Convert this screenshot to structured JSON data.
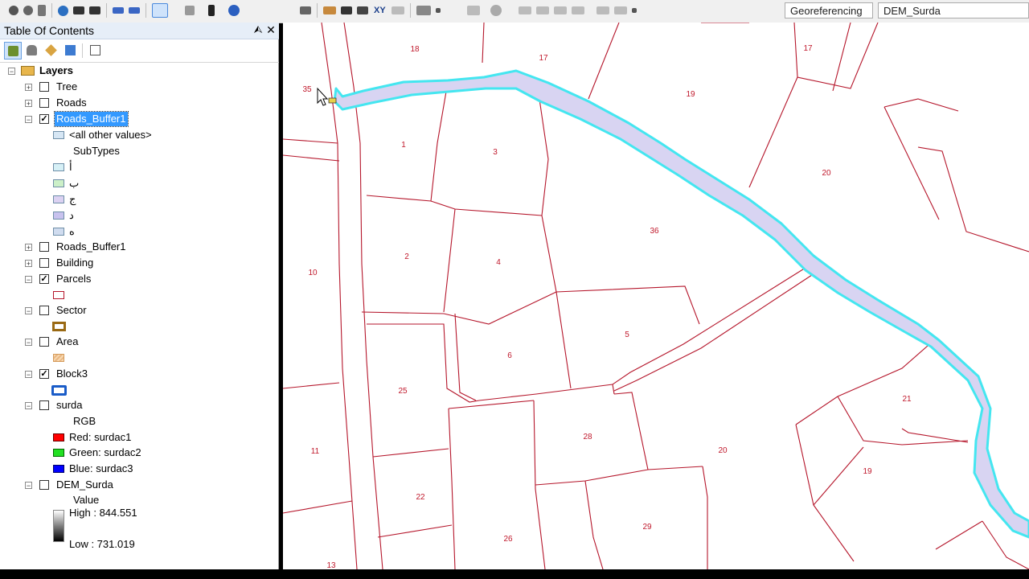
{
  "toolbar": {
    "xy_label": "XY",
    "georef_label": "Georeferencing",
    "layer_dropdown": "DEM_Surda"
  },
  "toc": {
    "title": "Table Of Contents",
    "pin_glyph": "⮙",
    "close_glyph": "✕",
    "root_label": "Layers",
    "layers": {
      "tree": "Tree",
      "roads": "Roads",
      "roads_buffer_selected": "Roads_Buffer1",
      "all_other_values": "<all other values>",
      "subtypes_header": "SubTypes",
      "sub_a": "أ",
      "sub_b": "ب",
      "sub_c": "ج",
      "sub_d": "د",
      "sub_e": "ه",
      "roads_buffer_2": "Roads_Buffer1",
      "building": "Building",
      "parcels": "Parcels",
      "sector": "Sector",
      "area": "Area",
      "block3": "Block3",
      "surda": "surda",
      "rgb": "RGB",
      "red": "Red:   surdac1",
      "green": "Green:  surdac2",
      "blue": "Blue:   surdac3",
      "dem": "DEM_Surda",
      "value": "Value",
      "high": "High : 844.551",
      "low": "Low : 731.019"
    },
    "checked": {
      "roads_buffer": true,
      "parcels": true,
      "block3": true
    }
  },
  "map": {
    "colors": {
      "parcel_line": "#b5162b",
      "buffer_fill": "#d8d4f2",
      "buffer_outline": "#44e6f0"
    },
    "parcel_labels": [
      "18",
      "17",
      "17",
      "35",
      "19",
      "1",
      "3",
      "20",
      "36",
      "10",
      "2",
      "4",
      "5",
      "6",
      "25",
      "21",
      "28",
      "11",
      "20",
      "19",
      "22",
      "29",
      "26",
      "13"
    ]
  }
}
